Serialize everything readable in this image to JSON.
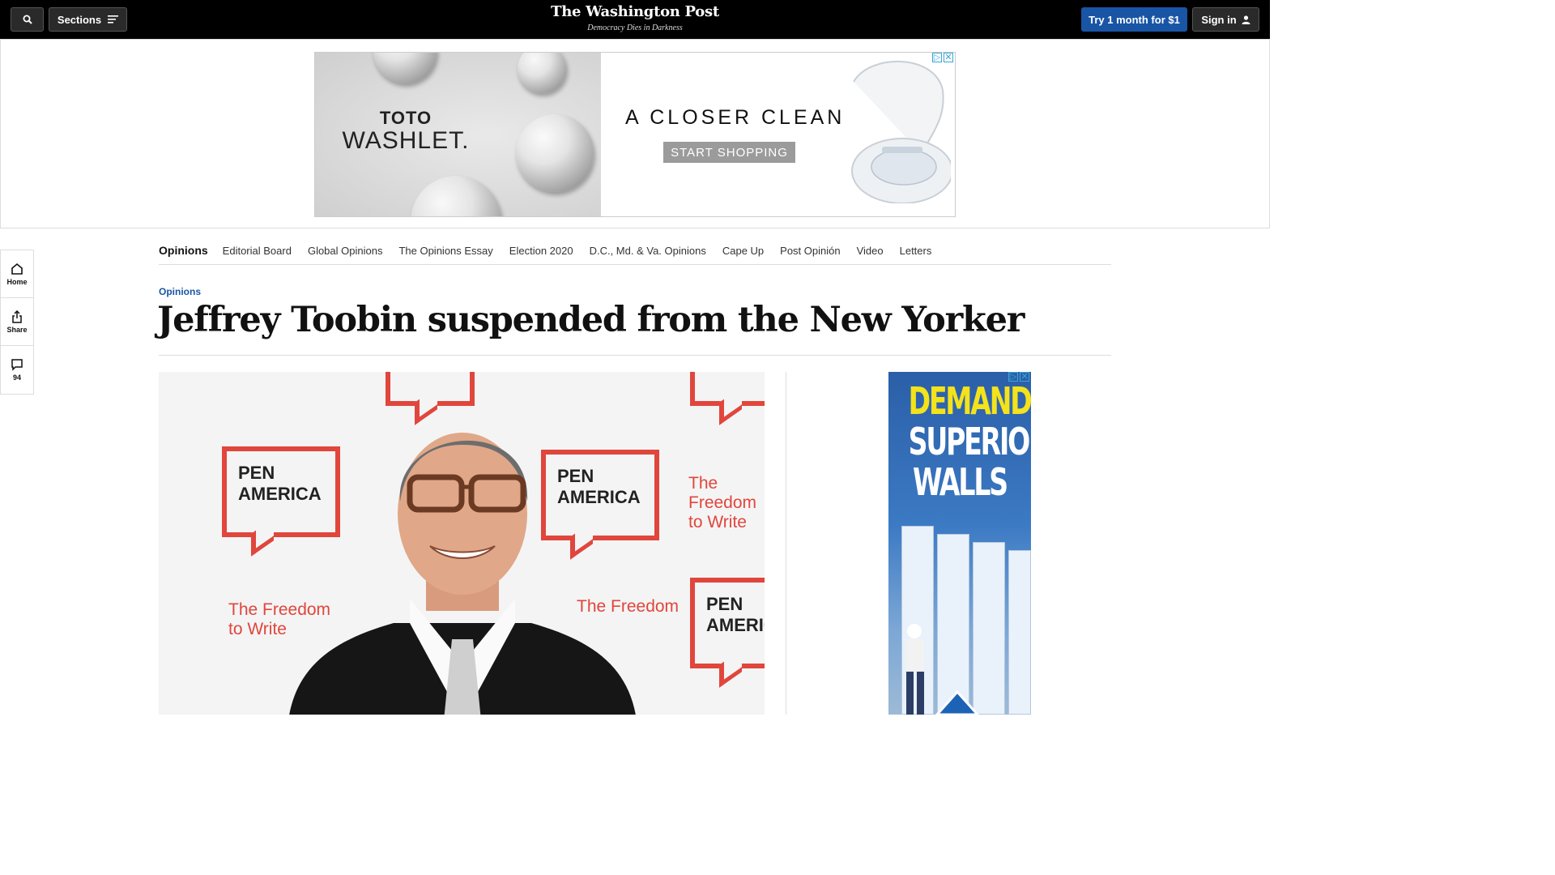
{
  "topbar": {
    "sections_label": "Sections",
    "logo": "The Washington Post",
    "tagline": "Democracy Dies in Darkness",
    "trial_label": "Try 1 month for $1",
    "signin_label": "Sign in"
  },
  "top_ad": {
    "brand_line1": "TOTO",
    "brand_line2": "WASHLET.",
    "headline": "A CLOSER CLEAN",
    "cta": "START SHOPPING"
  },
  "rail": {
    "home_label": "Home",
    "share_label": "Share",
    "comments_count": "94"
  },
  "subnav": {
    "items": [
      "Opinions",
      "Editorial Board",
      "Global Opinions",
      "The Opinions Essay",
      "Election 2020",
      "D.C., Md. & Va. Opinions",
      "Cape Up",
      "Post Opinión",
      "Video",
      "Letters"
    ]
  },
  "article": {
    "kicker": "Opinions",
    "headline": "Jeffrey Toobin suspended from the New Yorker"
  },
  "photo": {
    "pen_line1": "PEN",
    "pen_line2": "AMERICA",
    "freedom_line1": "The Freedom",
    "freedom_line2": "to Write"
  },
  "side_ad": {
    "line1": "DEMAND",
    "line2": "SUPERIOR",
    "line3": "WALLS"
  },
  "colors": {
    "brand_blue": "#1955a5",
    "pen_red": "#e0463c",
    "ad_yellow": "#f4e21b"
  }
}
